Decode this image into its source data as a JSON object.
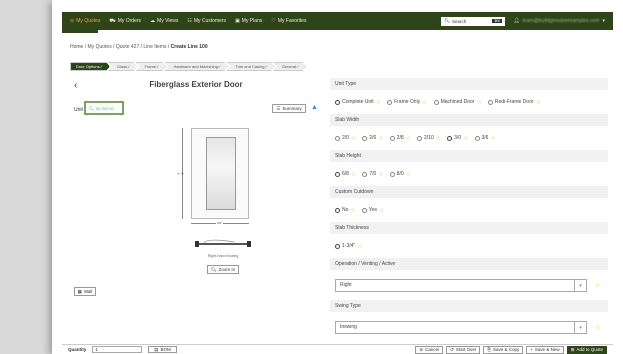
{
  "nav": {
    "items": [
      {
        "label": "My Quotes",
        "icon": "quote-icon",
        "active": true
      },
      {
        "label": "My Orders",
        "icon": "truck-icon",
        "active": false
      },
      {
        "label": "My Views",
        "icon": "views-icon",
        "active": false
      },
      {
        "label": "My Customers",
        "icon": "customers-icon",
        "active": false
      },
      {
        "label": "My Plans",
        "icon": "plans-icon",
        "active": false
      },
      {
        "label": "My Favorites",
        "icon": "heart-icon",
        "active": false
      }
    ],
    "search_label": "Search",
    "search_kbd": "⌘K",
    "user_email": "learn@buildgenuineexamples.com"
  },
  "breadcrumb": {
    "items": [
      "Home",
      "My Quotes",
      "Quote 427",
      "Line Items"
    ],
    "current": "Create Line 100"
  },
  "steps": [
    "Door Options",
    "Glass",
    "Frame",
    "Hardware and Machining",
    "Trim and Casing",
    "General"
  ],
  "door": {
    "title": "Fiberglass Exterior Door",
    "unit_label": "Unit",
    "unit_value": "$1,000.00",
    "summary_label": "Summary",
    "height_dim": "6' 8\"",
    "width_dim": "3'0\"",
    "hinge_label": "Right-Hand Inswing",
    "zoom_label": "Zoom In",
    "wall_label": "Wall"
  },
  "sections": [
    {
      "title": "Unit Type",
      "options": [
        {
          "label": "Complete Unit",
          "selected": true
        },
        {
          "label": "Frame Only",
          "selected": false
        },
        {
          "label": "Machined Door",
          "selected": false
        },
        {
          "label": "Redi-Frame Door",
          "selected": false
        }
      ]
    },
    {
      "title": "Slab Width",
      "options": [
        {
          "label": "2/0",
          "selected": false
        },
        {
          "label": "2/6",
          "selected": false
        },
        {
          "label": "2/8",
          "selected": false
        },
        {
          "label": "2/10",
          "selected": false
        },
        {
          "label": "3/0",
          "selected": true
        },
        {
          "label": "3/6",
          "selected": false
        }
      ]
    },
    {
      "title": "Slab Height",
      "options": [
        {
          "label": "6/8",
          "selected": true
        },
        {
          "label": "7/0",
          "selected": false
        },
        {
          "label": "8/0",
          "selected": false
        }
      ]
    },
    {
      "title": "Custom Cutdown",
      "options": [
        {
          "label": "No",
          "selected": true
        },
        {
          "label": "Yes",
          "selected": false
        }
      ]
    },
    {
      "title": "Slab Thickness",
      "options": [
        {
          "label": "1-3/4\"",
          "selected": true
        }
      ]
    }
  ],
  "selects": [
    {
      "title": "Operation / Venting / Active",
      "value": "Right"
    },
    {
      "title": "Swing Type",
      "value": "Inswing"
    }
  ],
  "footer": {
    "quantity_label": "Quantity",
    "quantity_value": "1",
    "bom_label": "BOM",
    "cancel": "Cancel",
    "start_over": "Start Over",
    "save_copy": "Save & Copy",
    "save_new": "Save & New",
    "add_to_quote": "Add to Quote"
  },
  "colors": {
    "nav_bg": "#2e4419",
    "active": "#f0a23c",
    "star": "#f2c21b",
    "unit_border": "#7aa35a"
  }
}
